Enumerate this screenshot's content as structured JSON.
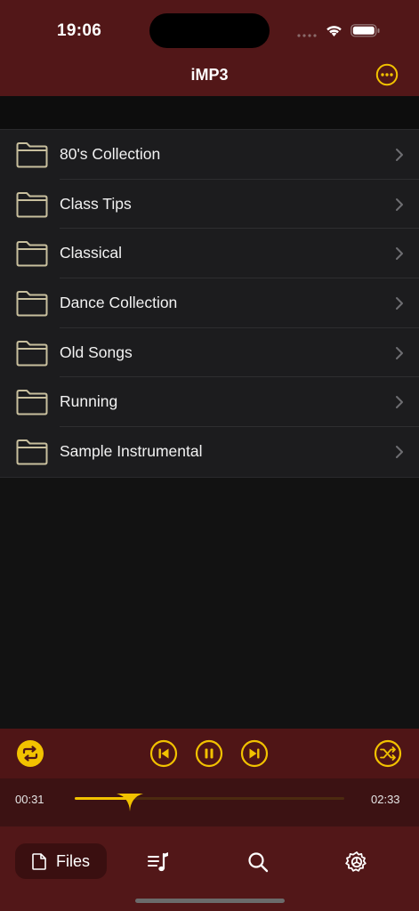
{
  "status": {
    "time": "19:06"
  },
  "nav": {
    "title": "iMP3",
    "more_icon": "ellipsis-circle-icon"
  },
  "folders": [
    {
      "name": "80's Collection"
    },
    {
      "name": "Class Tips"
    },
    {
      "name": "Classical"
    },
    {
      "name": "Dance Collection"
    },
    {
      "name": "Old Songs"
    },
    {
      "name": "Running"
    },
    {
      "name": "Sample Instrumental"
    }
  ],
  "player": {
    "current_time": "00:31",
    "total_time": "02:33",
    "progress_fraction": 0.203,
    "controls": [
      "repeat-icon",
      "previous-track-icon",
      "pause-icon",
      "next-track-icon",
      "shuffle-icon"
    ]
  },
  "tabs": {
    "files_label": "Files",
    "icons": [
      "document-icon",
      "playlist-icon",
      "search-icon",
      "settings-gear-icon"
    ]
  },
  "colors": {
    "accent": "#F2C200",
    "bar_background": "#521718",
    "list_background": "#1C1C1E",
    "folder_outline": "#C8BF9E"
  }
}
